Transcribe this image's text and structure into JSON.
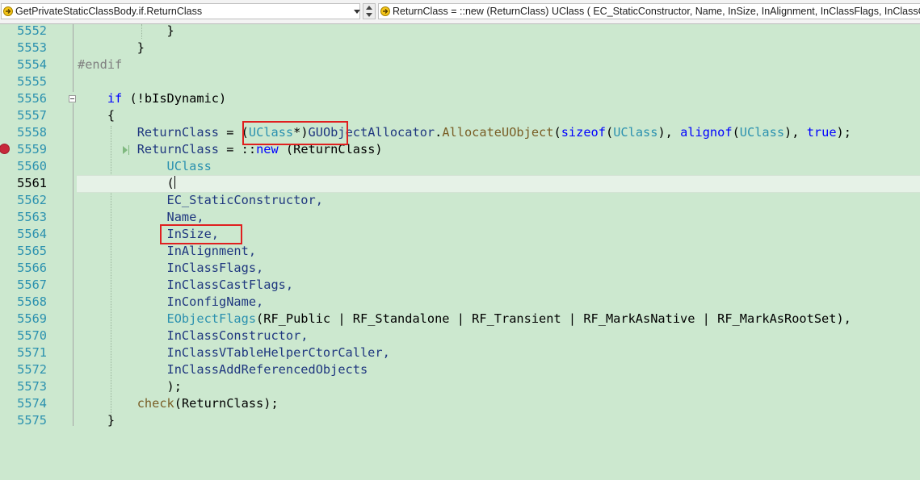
{
  "navbar": {
    "scope_combo": "GetPrivateStaticClassBody.if.ReturnClass",
    "member_combo": "ReturnClass = ::new (ReturnClass) UClass ( EC_StaticConstructor, Name, InSize, InAlignment, InClassFlags, InClassCastFlags"
  },
  "editor": {
    "current_line": "5561",
    "lines": [
      {
        "n": "5552"
      },
      {
        "n": "5553"
      },
      {
        "n": "5554"
      },
      {
        "n": "5555"
      },
      {
        "n": "5556"
      },
      {
        "n": "5557"
      },
      {
        "n": "5558"
      },
      {
        "n": "5559"
      },
      {
        "n": "5560"
      },
      {
        "n": "5561"
      },
      {
        "n": "5562"
      },
      {
        "n": "5563"
      },
      {
        "n": "5564"
      },
      {
        "n": "5565"
      },
      {
        "n": "5566"
      },
      {
        "n": "5567"
      },
      {
        "n": "5568"
      },
      {
        "n": "5569"
      },
      {
        "n": "5570"
      },
      {
        "n": "5571"
      },
      {
        "n": "5572"
      },
      {
        "n": "5573"
      },
      {
        "n": "5574"
      },
      {
        "n": "5575"
      }
    ],
    "tokens": {
      "brace_close": "}",
      "brace_open": "{",
      "endif": "#endif",
      "if_kw": "if",
      "not_dyn": " (!bIsDynamic)",
      "return_class": "ReturnClass",
      "eq": " = ",
      "paren_open": "(",
      "uclass": "UClass",
      "star_close": "*)",
      "guobj": "GUObjectAllocator",
      "dot": ".",
      "alloc": "AllocateUObject",
      "sizeof": "sizeof",
      "alignof": "alignof",
      "comma_sp": ", ",
      "close_comma": "), ",
      "true_kw": "true",
      "end_stmt": ");",
      "scope_new": "::",
      "new_kw": "new",
      "paren_rc": " (ReturnClass)",
      "ec_static": "EC_StaticConstructor,",
      "name": "Name,",
      "insize": "InSize,",
      "inalign": "InAlignment,",
      "inclassflags": "InClassFlags,",
      "incastflags": "InClassCastFlags,",
      "inconfig": "InConfigName,",
      "eobjflags": "EObjectFlags",
      "rf_public": "RF_Public",
      "pipe": " | ",
      "rf_standalone": "RF_Standalone",
      "rf_transient": "RF_Transient",
      "rf_native": "RF_MarkAsNative",
      "rf_rootset": "RF_MarkAsRootSet",
      "close_paren_comma": "),",
      "inctor": "InClassConstructor,",
      "invtable": "InClassVTableHelperCtorCaller,",
      "inaddref": "InClassAddReferencedObjects",
      "close_semicolon": ");",
      "check": "check",
      "check_args": "(ReturnClass);"
    }
  },
  "colors": {
    "editor_bg": "#cce8cf",
    "keyword": "#0000ff",
    "type": "#2b91af",
    "function": "#795e26",
    "line_number": "#2b91af",
    "highlight_box": "#e01f1f",
    "breakpoint": "#c7283a"
  },
  "icons": {
    "combo": "arrow-right-icon",
    "breakpoint": "breakpoint-icon",
    "step": "step-arrow-icon",
    "collapse": "collapse-minus-icon"
  }
}
